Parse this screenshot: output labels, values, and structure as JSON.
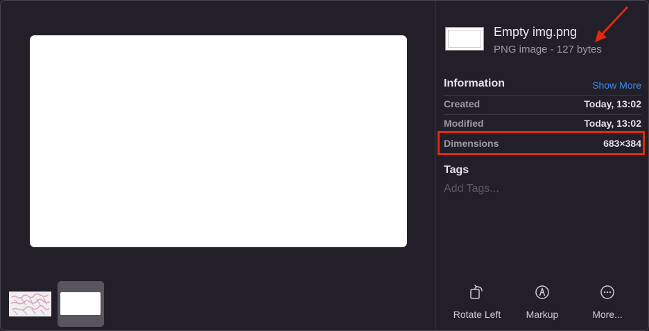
{
  "file": {
    "name": "Empty img.png",
    "kind": "PNG image - 127 bytes"
  },
  "information": {
    "title": "Information",
    "show_more": "Show More",
    "rows": [
      {
        "label": "Created",
        "value": "Today, 13:02"
      },
      {
        "label": "Modified",
        "value": "Today, 13:02"
      },
      {
        "label": "Dimensions",
        "value": "683×384"
      }
    ]
  },
  "tags": {
    "title": "Tags",
    "placeholder": "Add Tags..."
  },
  "toolbar": {
    "rotate_left": "Rotate Left",
    "markup": "Markup",
    "more": "More..."
  },
  "colors": {
    "background": "#231f29",
    "accent": "#3c8df0",
    "annotation": "#e02a0f"
  },
  "icons": [
    "rotate-left-icon",
    "markup-icon",
    "more-icon",
    "annotation-arrow-icon"
  ]
}
